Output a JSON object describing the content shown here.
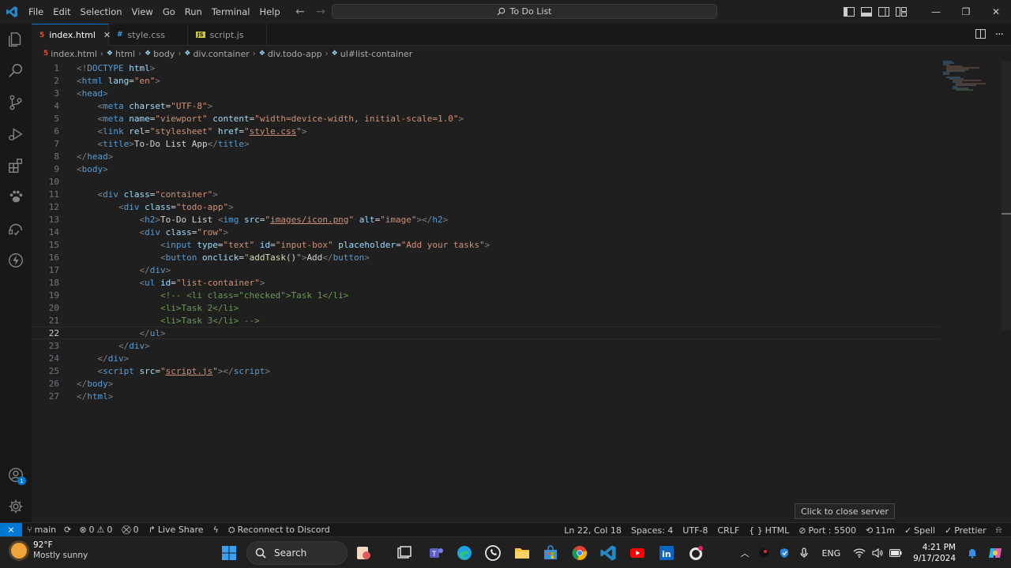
{
  "menu": [
    "File",
    "Edit",
    "Selection",
    "View",
    "Go",
    "Run",
    "Terminal",
    "Help"
  ],
  "command_center": {
    "label": "To Do List"
  },
  "tabs": [
    {
      "name": "index.html",
      "icon": "html-file-icon",
      "active": true
    },
    {
      "name": "style.css",
      "icon": "css-file-icon",
      "active": false
    },
    {
      "name": "script.js",
      "icon": "js-file-icon",
      "active": false
    }
  ],
  "breadcrumb": [
    "index.html",
    "html",
    "body",
    "div.container",
    "div.todo-app",
    "ul#list-container"
  ],
  "editor": {
    "current_line": 22,
    "line_numbers": [
      "1",
      "2",
      "3",
      "4",
      "5",
      "6",
      "7",
      "8",
      "9",
      "10",
      "11",
      "12",
      "13",
      "14",
      "15",
      "16",
      "17",
      "18",
      "19",
      "20",
      "21",
      "22",
      "23",
      "24",
      "25",
      "26",
      "27"
    ]
  },
  "accounts_badge": "1",
  "tooltip": "Click to close server",
  "statusbar": {
    "branch": "main",
    "errors": "0",
    "warnings": "0",
    "ports": "0",
    "live_share": "Live Share",
    "discord": "Reconnect to Discord",
    "cursor": "Ln 22, Col 18",
    "spaces": "Spaces: 4",
    "encoding": "UTF-8",
    "eol": "CRLF",
    "language": "HTML",
    "port": "Port : 5500",
    "time": "11m",
    "spell": "Spell",
    "prettier": "Prettier"
  },
  "taskbar": {
    "weather_temp": "92°F",
    "weather_desc": "Mostly sunny",
    "search_placeholder": "Search",
    "language": "ENG",
    "time": "4:21 PM",
    "date": "9/17/2024"
  },
  "colors": {
    "accent": "#0078d4",
    "editor_bg": "#1f1f1f",
    "sidebar_bg": "#181818"
  }
}
